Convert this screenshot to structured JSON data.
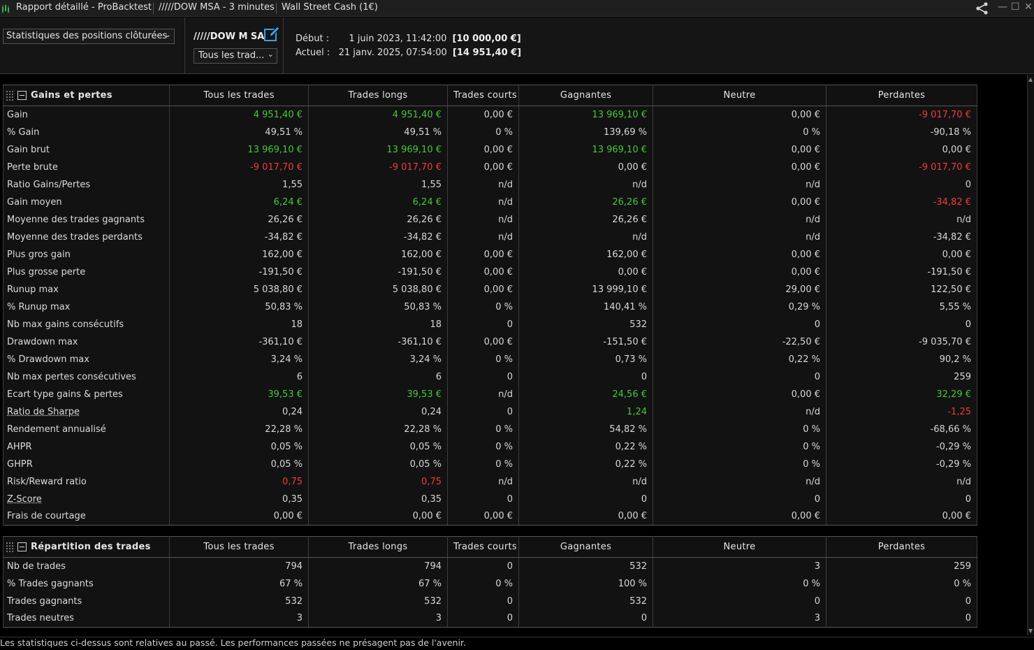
{
  "titlebar": {
    "tabs": [
      "Rapport détaillé - ProBacktest",
      "/////DOW MSA - 3 minutes",
      "Wall Street Cash (1€)"
    ],
    "icons": [
      "chart-app-icon",
      "share-icon",
      "minimize-icon",
      "maximize-icon",
      "close-icon"
    ]
  },
  "header": {
    "stats_select": "Statistiques des positions clôturées",
    "system_name": "/////DOW M SA",
    "trades_select": "Tous les trad...",
    "start_label": "Début :",
    "start_date": "1 juin 2023, 11:42:00",
    "start_value": "[10 000,00 €]",
    "current_label": "Actuel :",
    "current_date": "21 janv. 2025, 07:54:00",
    "current_value": "[14 951,40 €]"
  },
  "colors": {
    "positive": "#46c73c",
    "negative": "#f03c3c",
    "text": "#d8d8d8"
  },
  "columns": [
    "Tous les trades",
    "Trades longs",
    "Trades courts",
    "Gagnantes",
    "Neutre",
    "Perdantes"
  ],
  "gains": {
    "title": "Gains et pertes",
    "rows": [
      {
        "label": "Gain",
        "values": [
          "4 951,40 €",
          "4 951,40 €",
          "0,00 €",
          "13 969,10 €",
          "0,00 €",
          "-9 017,70 €"
        ],
        "colors": [
          "pos",
          "pos",
          "",
          "pos",
          "",
          "neg"
        ]
      },
      {
        "label": "% Gain",
        "values": [
          "49,51 %",
          "49,51 %",
          "0 %",
          "139,69 %",
          "0 %",
          "-90,18 %"
        ]
      },
      {
        "label": "Gain brut",
        "values": [
          "13 969,10 €",
          "13 969,10 €",
          "0,00 €",
          "13 969,10 €",
          "0,00 €",
          "0,00 €"
        ],
        "colors": [
          "pos",
          "pos",
          "",
          "pos",
          "",
          ""
        ]
      },
      {
        "label": "Perte brute",
        "values": [
          "-9 017,70 €",
          "-9 017,70 €",
          "0,00 €",
          "0,00 €",
          "0,00 €",
          "-9 017,70 €"
        ],
        "colors": [
          "neg",
          "neg",
          "",
          "",
          "",
          "neg"
        ]
      },
      {
        "label": "Ratio Gains/Pertes",
        "values": [
          "1,55",
          "1,55",
          "n/d",
          "n/d",
          "n/d",
          "0"
        ]
      },
      {
        "label": "Gain moyen",
        "values": [
          "6,24 €",
          "6,24 €",
          "n/d",
          "26,26 €",
          "0,00 €",
          "-34,82 €"
        ],
        "colors": [
          "pos",
          "pos",
          "",
          "pos",
          "",
          "neg"
        ]
      },
      {
        "label": "Moyenne des trades gagnants",
        "values": [
          "26,26 €",
          "26,26 €",
          "n/d",
          "26,26 €",
          "n/d",
          "n/d"
        ]
      },
      {
        "label": "Moyenne des trades perdants",
        "values": [
          "-34,82 €",
          "-34,82 €",
          "n/d",
          "n/d",
          "n/d",
          "-34,82 €"
        ]
      },
      {
        "label": "Plus gros gain",
        "values": [
          "162,00 €",
          "162,00 €",
          "0,00 €",
          "162,00 €",
          "0,00 €",
          "0,00 €"
        ]
      },
      {
        "label": "Plus grosse perte",
        "values": [
          "-191,50 €",
          "-191,50 €",
          "0,00 €",
          "0,00 €",
          "0,00 €",
          "-191,50 €"
        ]
      },
      {
        "label": "Runup max",
        "values": [
          "5 038,80 €",
          "5 038,80 €",
          "0,00 €",
          "13 999,10 €",
          "29,00 €",
          "122,50 €"
        ]
      },
      {
        "label": "% Runup max",
        "values": [
          "50,83 %",
          "50,83 %",
          "0 %",
          "140,41 %",
          "0,29 %",
          "5,55 %"
        ]
      },
      {
        "label": "Nb max gains consécutifs",
        "values": [
          "18",
          "18",
          "0",
          "532",
          "0",
          "0"
        ]
      },
      {
        "label": "Drawdown max",
        "values": [
          "-361,10 €",
          "-361,10 €",
          "0,00 €",
          "-151,50 €",
          "-22,50 €",
          "-9 035,70 €"
        ]
      },
      {
        "label": "% Drawdown max",
        "values": [
          "3,24 %",
          "3,24 %",
          "0 %",
          "0,73 %",
          "0,22 %",
          "90,2 %"
        ]
      },
      {
        "label": "Nb max pertes consécutives",
        "values": [
          "6",
          "6",
          "0",
          "0",
          "0",
          "259"
        ]
      },
      {
        "label": "Ecart type gains & pertes",
        "values": [
          "39,53 €",
          "39,53 €",
          "n/d",
          "24,56 €",
          "0,00 €",
          "32,29 €"
        ],
        "colors": [
          "pos",
          "pos",
          "",
          "pos",
          "",
          "pos"
        ]
      },
      {
        "label": "Ratio de Sharpe",
        "underline": true,
        "values": [
          "0,24",
          "0,24",
          "0",
          "1,24",
          "n/d",
          "-1,25"
        ],
        "colors": [
          "",
          "",
          "",
          "pos",
          "",
          "neg"
        ]
      },
      {
        "label": "Rendement annualisé",
        "values": [
          "22,28 %",
          "22,28 %",
          "0 %",
          "54,82 %",
          "0 %",
          "-68,66 %"
        ]
      },
      {
        "label": "AHPR",
        "values": [
          "0,05 %",
          "0,05 %",
          "0 %",
          "0,22 %",
          "0 %",
          "-0,29 %"
        ]
      },
      {
        "label": "GHPR",
        "values": [
          "0,05 %",
          "0,05 %",
          "0 %",
          "0,22 %",
          "0 %",
          "-0,29 %"
        ]
      },
      {
        "label": "Risk/Reward ratio",
        "values": [
          "0,75",
          "0,75",
          "n/d",
          "n/d",
          "n/d",
          "n/d"
        ],
        "colors": [
          "neg",
          "neg",
          "",
          "",
          "",
          ""
        ]
      },
      {
        "label": "Z-Score",
        "underline": true,
        "values": [
          "0,35",
          "0,35",
          "0",
          "0",
          "0",
          "0"
        ]
      },
      {
        "label": "Frais de courtage",
        "values": [
          "0,00 €",
          "0,00 €",
          "0,00 €",
          "0,00 €",
          "0,00 €",
          "0,00 €"
        ]
      }
    ]
  },
  "repartition": {
    "title": "Répartition des trades",
    "rows": [
      {
        "label": "Nb de trades",
        "values": [
          "794",
          "794",
          "0",
          "532",
          "3",
          "259"
        ]
      },
      {
        "label": "% Trades gagnants",
        "values": [
          "67 %",
          "67 %",
          "0 %",
          "100 %",
          "0 %",
          "0 %"
        ]
      },
      {
        "label": "Trades gagnants",
        "values": [
          "532",
          "532",
          "0",
          "532",
          "0",
          "0"
        ]
      },
      {
        "label": "Trades neutres",
        "values": [
          "3",
          "3",
          "0",
          "0",
          "3",
          "0"
        ]
      }
    ]
  },
  "footer": "Les statistiques ci-dessus sont relatives au passé. Les performances passées ne présagent pas de l'avenir."
}
